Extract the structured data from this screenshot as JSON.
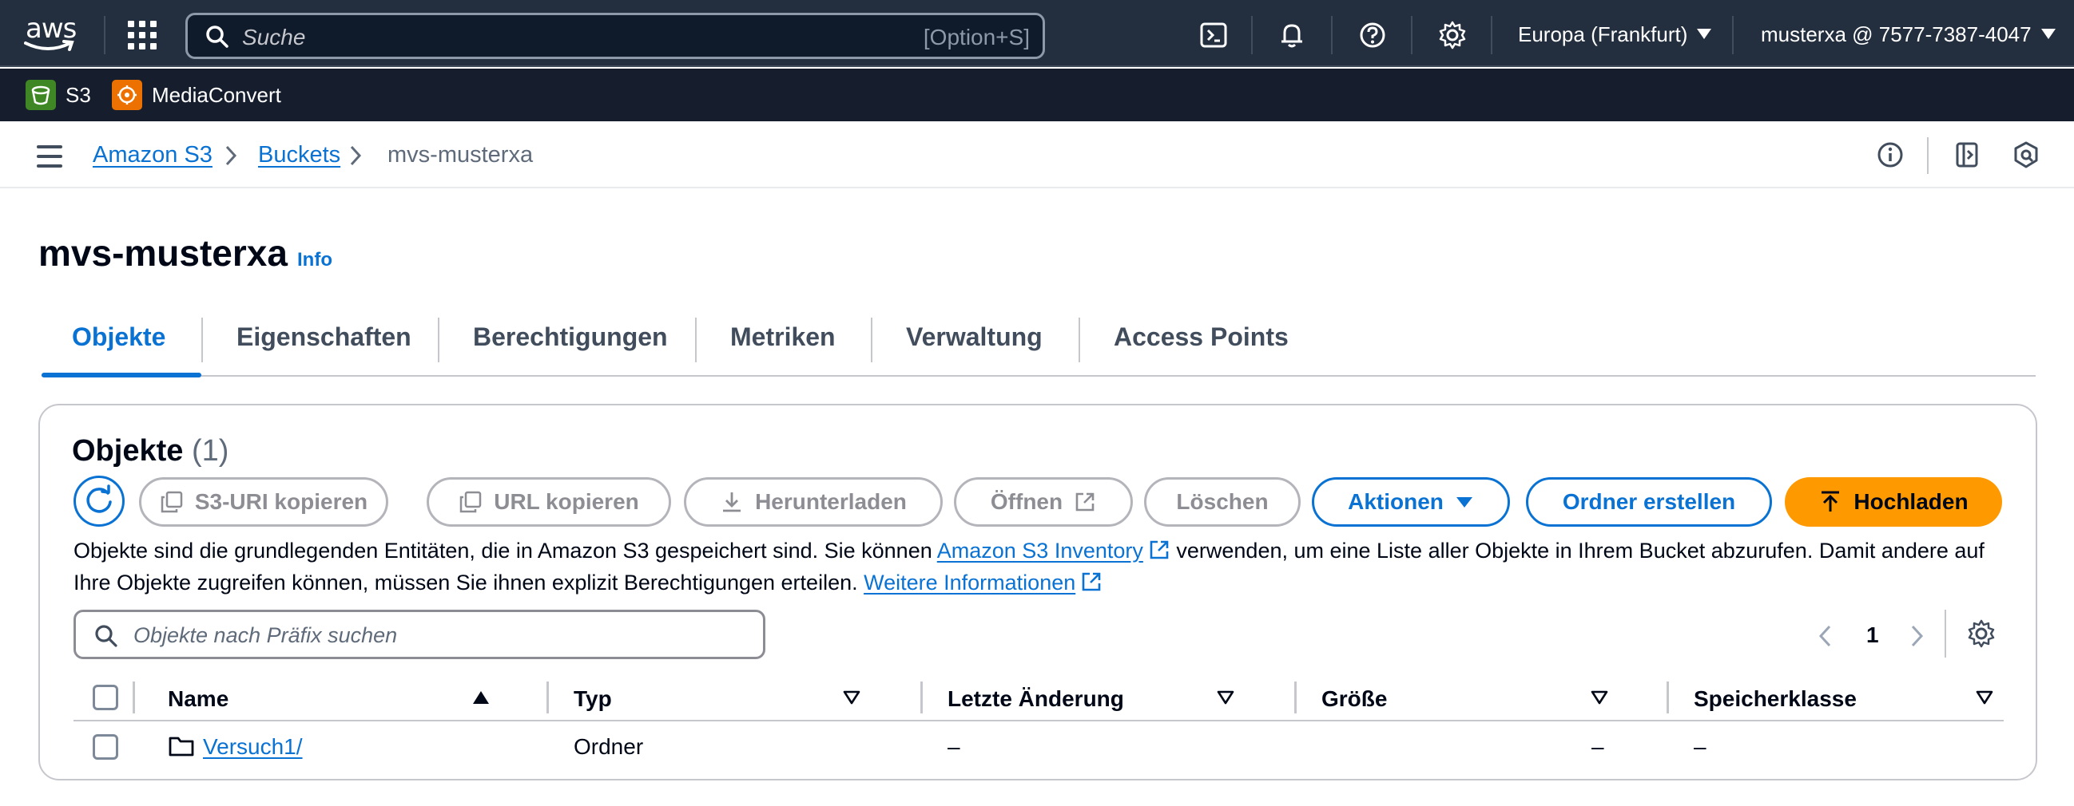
{
  "topnav": {
    "logo_text": "aws",
    "search_placeholder": "Suche",
    "search_shortcut": "[Option+S]",
    "region": "Europa (Frankfurt)",
    "account": "musterxa @ 7577-7387-4047",
    "icons": [
      "cloudshell-icon",
      "bell-icon",
      "help-icon",
      "gear-icon"
    ]
  },
  "favorites": [
    {
      "label": "S3",
      "color": "#3f8624",
      "icon": "s3-service-icon"
    },
    {
      "label": "MediaConvert",
      "color": "#ed7100",
      "icon": "mediaconvert-service-icon"
    }
  ],
  "breadcrumb": {
    "items": [
      "Amazon S3",
      "Buckets"
    ],
    "current": "mvs-musterxa"
  },
  "page": {
    "title": "mvs-musterxa",
    "info": "Info"
  },
  "tabs": [
    "Objekte",
    "Eigenschaften",
    "Berechtigungen",
    "Metriken",
    "Verwaltung",
    "Access Points"
  ],
  "active_tab": "Objekte",
  "objects": {
    "title": "Objekte",
    "count": "(1)",
    "buttons": {
      "copy_s3_uri": "S3-URI kopieren",
      "copy_url": "URL kopieren",
      "download": "Herunterladen",
      "open": "Öffnen",
      "delete": "Löschen",
      "actions": "Aktionen",
      "create_folder": "Ordner erstellen",
      "upload": "Hochladen"
    },
    "description_part1": "Objekte sind die grundlegenden Entitäten, die in Amazon S3 gespeichert sind. Sie können ",
    "description_link1": "Amazon S3 Inventory",
    "description_part2": " verwenden, um eine Liste aller Objekte in Ihrem Bucket abzurufen. Damit andere auf Ihre Objekte zugreifen können, müssen Sie ihnen explizit Berechtigungen erteilen. ",
    "description_link2": "Weitere Informationen",
    "filter_placeholder": "Objekte nach Präfix suchen",
    "page_number": "1",
    "columns": [
      "Name",
      "Typ",
      "Letzte Änderung",
      "Größe",
      "Speicherklasse"
    ],
    "rows": [
      {
        "name": "Versuch1/",
        "type": "Ordner",
        "modified": "–",
        "size": "–",
        "storage_class": "–"
      }
    ]
  },
  "colors": {
    "nav_bg": "#232f3e",
    "fav_bg": "#161e2d",
    "link": "#0972d3",
    "primary": "#ff9900"
  }
}
